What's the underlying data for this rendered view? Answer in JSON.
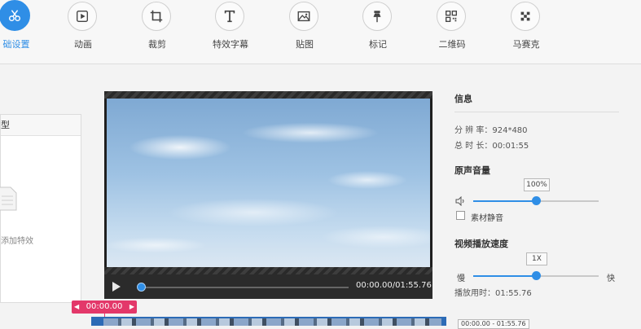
{
  "toolbar": {
    "items": [
      {
        "label": "础设置",
        "icon": "scissors-icon",
        "active": true
      },
      {
        "label": "动画",
        "icon": "play-square-icon"
      },
      {
        "label": "裁剪",
        "icon": "crop-icon"
      },
      {
        "label": "特效字幕",
        "icon": "text-t-icon"
      },
      {
        "label": "贴图",
        "icon": "image-icon"
      },
      {
        "label": "标记",
        "icon": "pin-icon"
      },
      {
        "label": "二维码",
        "icon": "qrcode-icon"
      },
      {
        "label": "马赛克",
        "icon": "mosaic-icon"
      }
    ],
    "accent": "#2f8ee6"
  },
  "effects_panel": {
    "header": "型",
    "hint": "添加特效"
  },
  "player": {
    "timecode": "00:00.00/01:55.76",
    "progress": 0.0
  },
  "info": {
    "title": "信息",
    "resolution_label": "分 辨 率：",
    "resolution": "924*480",
    "duration_label": "总 时 长：",
    "duration": "00:01:55"
  },
  "volume": {
    "title": "原声音量",
    "value": "100%",
    "level": 0.5,
    "mute_label": "素材静音"
  },
  "speed": {
    "title": "视频播放速度",
    "value": "1X",
    "level": 0.5,
    "slow": "慢",
    "fast": "快",
    "play_time_label": "播放用时：",
    "play_time": "01:55.76"
  },
  "timeline": {
    "current": "00:00.00",
    "clip_label": "00:00.00 - 01:55.76"
  }
}
